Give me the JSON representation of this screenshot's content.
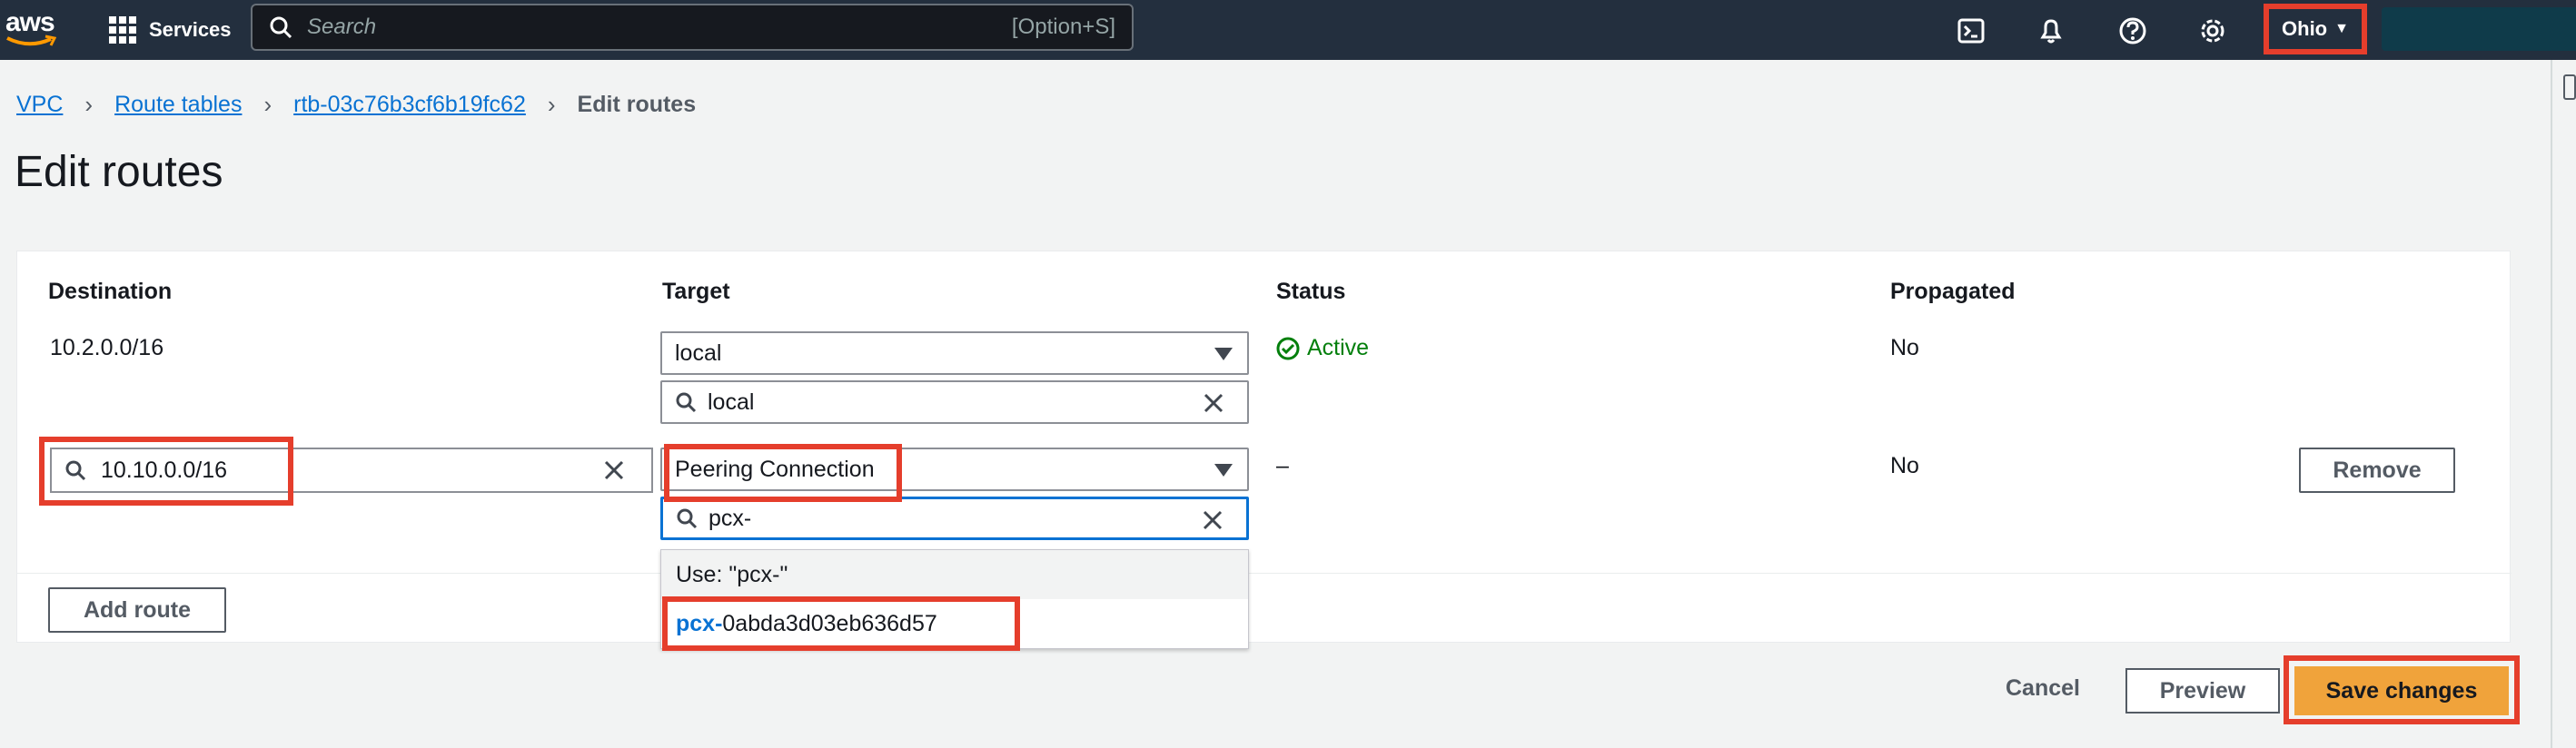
{
  "nav": {
    "logo_text": "aws",
    "services_label": "Services",
    "search_placeholder": "Search",
    "search_shortcut": "[Option+S]",
    "region": "Ohio",
    "icons": [
      "cloudshell-icon",
      "bell-icon",
      "help-icon",
      "gear-icon"
    ]
  },
  "breadcrumb": {
    "items": [
      "VPC",
      "Route tables",
      "rtb-03c76b3cf6b19fc62"
    ],
    "current": "Edit routes"
  },
  "page_title": "Edit routes",
  "table": {
    "headers": {
      "destination": "Destination",
      "target": "Target",
      "status": "Status",
      "propagated": "Propagated"
    },
    "rows": [
      {
        "destination": "10.2.0.0/16",
        "target_select": "local",
        "target_filter": "local",
        "status": "Active",
        "propagated": "No"
      },
      {
        "destination": "10.10.0.0/16",
        "target_select": "Peering Connection",
        "target_filter": "pcx-",
        "status": "–",
        "propagated": "No",
        "remove_label": "Remove"
      }
    ],
    "dropdown": {
      "use_label": "Use: \"pcx-\"",
      "option_prefix": "pcx-",
      "option_rest": "0abda3d03eb636d57"
    },
    "add_route_label": "Add route"
  },
  "actions": {
    "cancel": "Cancel",
    "preview": "Preview",
    "save": "Save changes"
  },
  "colors": {
    "nav_bg": "#232f3e",
    "link": "#0972d3",
    "highlight_box": "#e53e2c",
    "primary_button": "#f0a33b",
    "status_active": "#037f0c"
  }
}
